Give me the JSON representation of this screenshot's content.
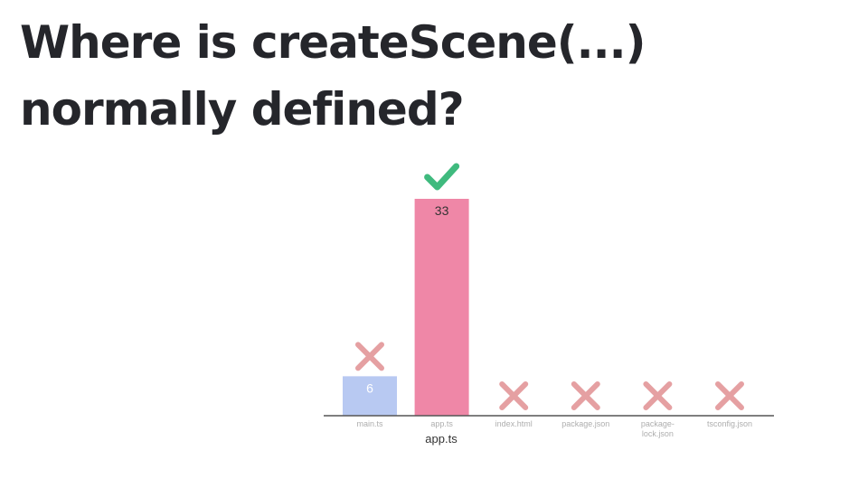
{
  "title": "Where is createScene(...) normally defined?",
  "answer_caption": "app.ts",
  "chart_data": {
    "type": "bar",
    "categories": [
      "main.ts",
      "app.ts",
      "index.html",
      "package.json",
      "package-lock.json",
      "tsconfig.json"
    ],
    "values": [
      6,
      33,
      0,
      0,
      0,
      0
    ],
    "status": [
      "wrong",
      "correct",
      "wrong",
      "wrong",
      "wrong",
      "wrong"
    ],
    "ylim": [
      0,
      33
    ],
    "title": "",
    "xlabel": "",
    "ylabel": "",
    "colors": {
      "correct": "#ef87a7",
      "wrong": "#b8c9f2",
      "check_icon": "#3fba7e",
      "cross_icon": "#e5a0a2",
      "axis": "#555555",
      "tick_label": "#aeaeae",
      "value_label_dark": "#333333",
      "value_label_light": "#ffffff"
    },
    "icons": {
      "correct": "check-icon",
      "wrong": "cross-icon"
    }
  }
}
